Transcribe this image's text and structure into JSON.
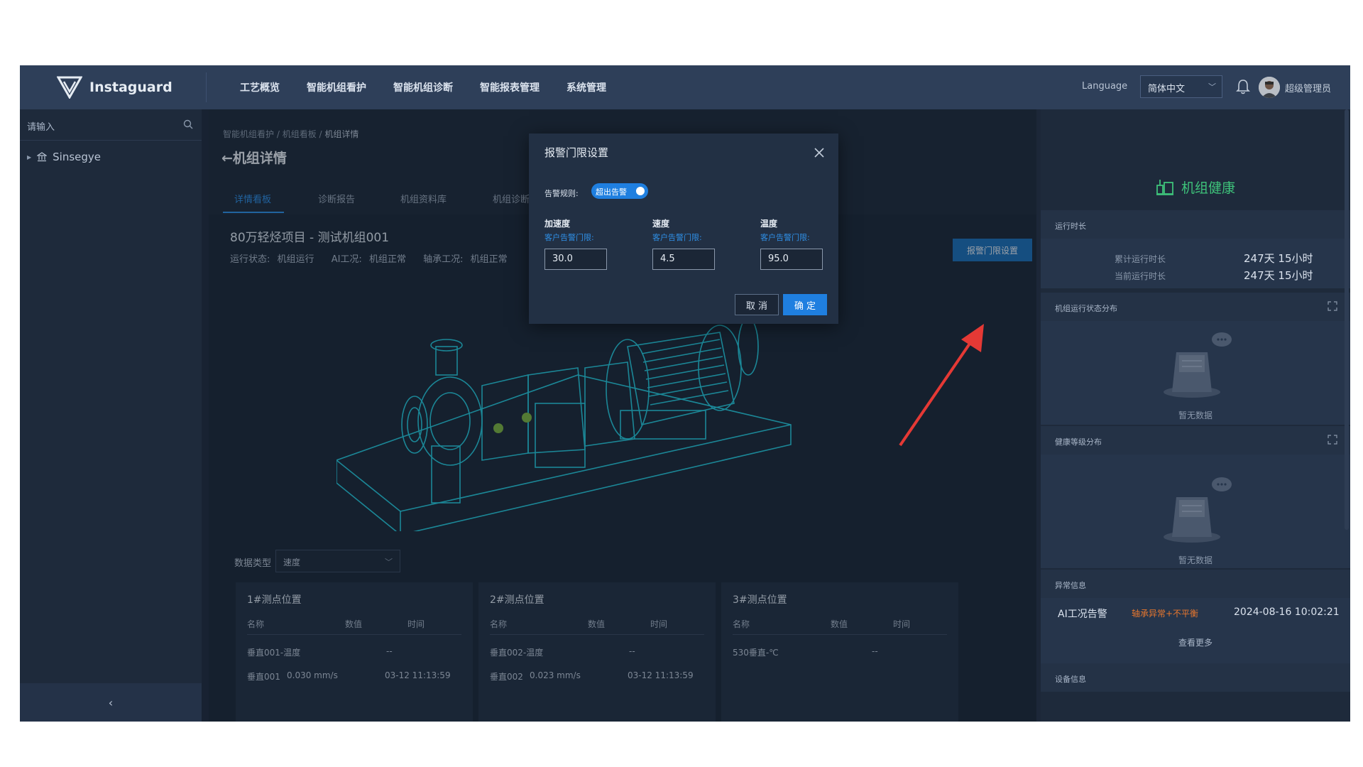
{
  "brand": {
    "name": "Instaguard"
  },
  "nav": [
    "工艺概览",
    "智能机组看护",
    "智能机组诊断",
    "智能报表管理",
    "系统管理"
  ],
  "header": {
    "language_label": "Language",
    "language_value": "简体中文",
    "user": "超级管理员"
  },
  "sidebar": {
    "search_placeholder": "请输入",
    "tree_root": "Sinsegye"
  },
  "breadcrumb": {
    "b1": "智能机组看护",
    "sep": " / ",
    "b2": "机组看板",
    "b3": "机组详情"
  },
  "page_title": "←机组详情",
  "tabs": [
    "详情看板",
    "诊断报告",
    "机组资料库",
    "机组诊断"
  ],
  "project": {
    "title": "80万轻烃项目 - 测试机组001",
    "run_status_label": "运行状态:",
    "run_status": "机组运行",
    "ai_label": "AI工况:",
    "ai_status": "机组正常",
    "bearing_label": "轴承工况:",
    "bearing_status": "机组正常"
  },
  "alarm_button": "报警门限设置",
  "data_type": {
    "label": "数据类型",
    "value": "速度"
  },
  "cards": [
    {
      "title": "1#测点位置",
      "headers": [
        "名称",
        "数值",
        "时间"
      ],
      "rows": [
        [
          "垂直001-温度",
          "--",
          ""
        ],
        [
          "垂直001",
          "0.030 mm/s",
          "03-12 11:13:59"
        ]
      ]
    },
    {
      "title": "2#测点位置",
      "headers": [
        "名称",
        "数值",
        "时间"
      ],
      "rows": [
        [
          "垂直002-温度",
          "--",
          ""
        ],
        [
          "垂直002",
          "0.023 mm/s",
          "03-12 11:13:59"
        ]
      ]
    },
    {
      "title": "3#测点位置",
      "headers": [
        "名称",
        "数值",
        "时间"
      ],
      "rows": [
        [
          "530垂直-℃",
          "--",
          ""
        ]
      ]
    }
  ],
  "right_panel": {
    "health_title": "机组健康",
    "runtime_head": "运行时长",
    "total_label": "累计运行时长",
    "total_value": "247天 15小时",
    "current_label": "当前运行时长",
    "current_value": "247天 15小时",
    "state_dist_head": "机组运行状态分布",
    "no_data": "暂无数据",
    "health_dist_head": "健康等级分布",
    "abnormal_head": "异常信息",
    "abnormal_type": "AI工况告警",
    "abnormal_desc": "轴承异常+不平衡",
    "abnormal_time": "2024-08-16 10:02:21",
    "more": "查看更多",
    "device_head": "设备信息"
  },
  "dialog": {
    "title": "报警门限设置",
    "rule_label": "告警规则:",
    "rule_value": "超出告警",
    "fields": [
      {
        "name": "加速度",
        "sub": "客户告警门限:",
        "value": "30.0"
      },
      {
        "name": "速度",
        "sub": "客户告警门限:",
        "value": "4.5"
      },
      {
        "name": "温度",
        "sub": "客户告警门限:",
        "value": "95.0"
      }
    ],
    "cancel": "取 消",
    "ok": "确 定"
  },
  "colors": {
    "accent": "#1f7fe0",
    "health": "#3ec27a",
    "warning": "#e8772e",
    "arrow": "#e53935",
    "machine": "#26c6da"
  }
}
